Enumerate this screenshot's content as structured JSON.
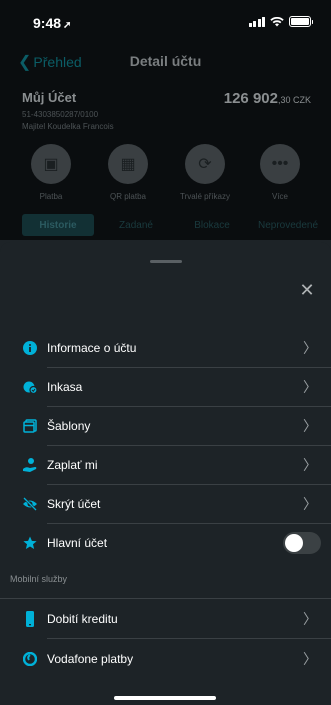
{
  "status": {
    "time": "9:48"
  },
  "nav": {
    "back_label": "Přehled",
    "title": "Detail účtu"
  },
  "account": {
    "name": "Můj Účet",
    "number": "51-4303850287/0100",
    "owner": "Majitel Koudelka Francois",
    "balance_main": "126 902",
    "balance_cents": ",30 CZK"
  },
  "actions": [
    {
      "label": "Platba",
      "icon": "wallet-icon"
    },
    {
      "label": "QR platba",
      "icon": "qr-icon"
    },
    {
      "label": "Trvalé příkazy",
      "icon": "repeat-icon"
    },
    {
      "label": "Více",
      "icon": "more-icon"
    }
  ],
  "tabs": [
    "Historie",
    "Zadané",
    "Blokace",
    "Neprovedené"
  ],
  "sheet": {
    "items": [
      {
        "label": "Informace o účtu",
        "icon": "info-icon",
        "color": "#00b1d8"
      },
      {
        "label": "Inkasa",
        "icon": "direct-debit-icon",
        "color": "#00b1d8"
      },
      {
        "label": "Šablony",
        "icon": "templates-icon",
        "color": "#00b1d8"
      },
      {
        "label": "Zaplať mi",
        "icon": "request-payment-icon",
        "color": "#00b1d8"
      },
      {
        "label": "Skrýt účet",
        "icon": "hide-icon",
        "color": "#00b1d8"
      },
      {
        "label": "Hlavní účet",
        "icon": "star-icon",
        "color": "#00b1d8",
        "toggle_on": false
      }
    ],
    "section_title": "Mobilní služby",
    "services": [
      {
        "label": "Dobití kreditu",
        "icon": "phone-icon",
        "color": "#00b1d8"
      },
      {
        "label": "Vodafone platby",
        "icon": "vodafone-icon",
        "color": "#00b1d8"
      }
    ]
  },
  "colors": {
    "accent": "#00b1d8",
    "sheet_bg": "#1d2327",
    "divider": "#3a4044"
  }
}
